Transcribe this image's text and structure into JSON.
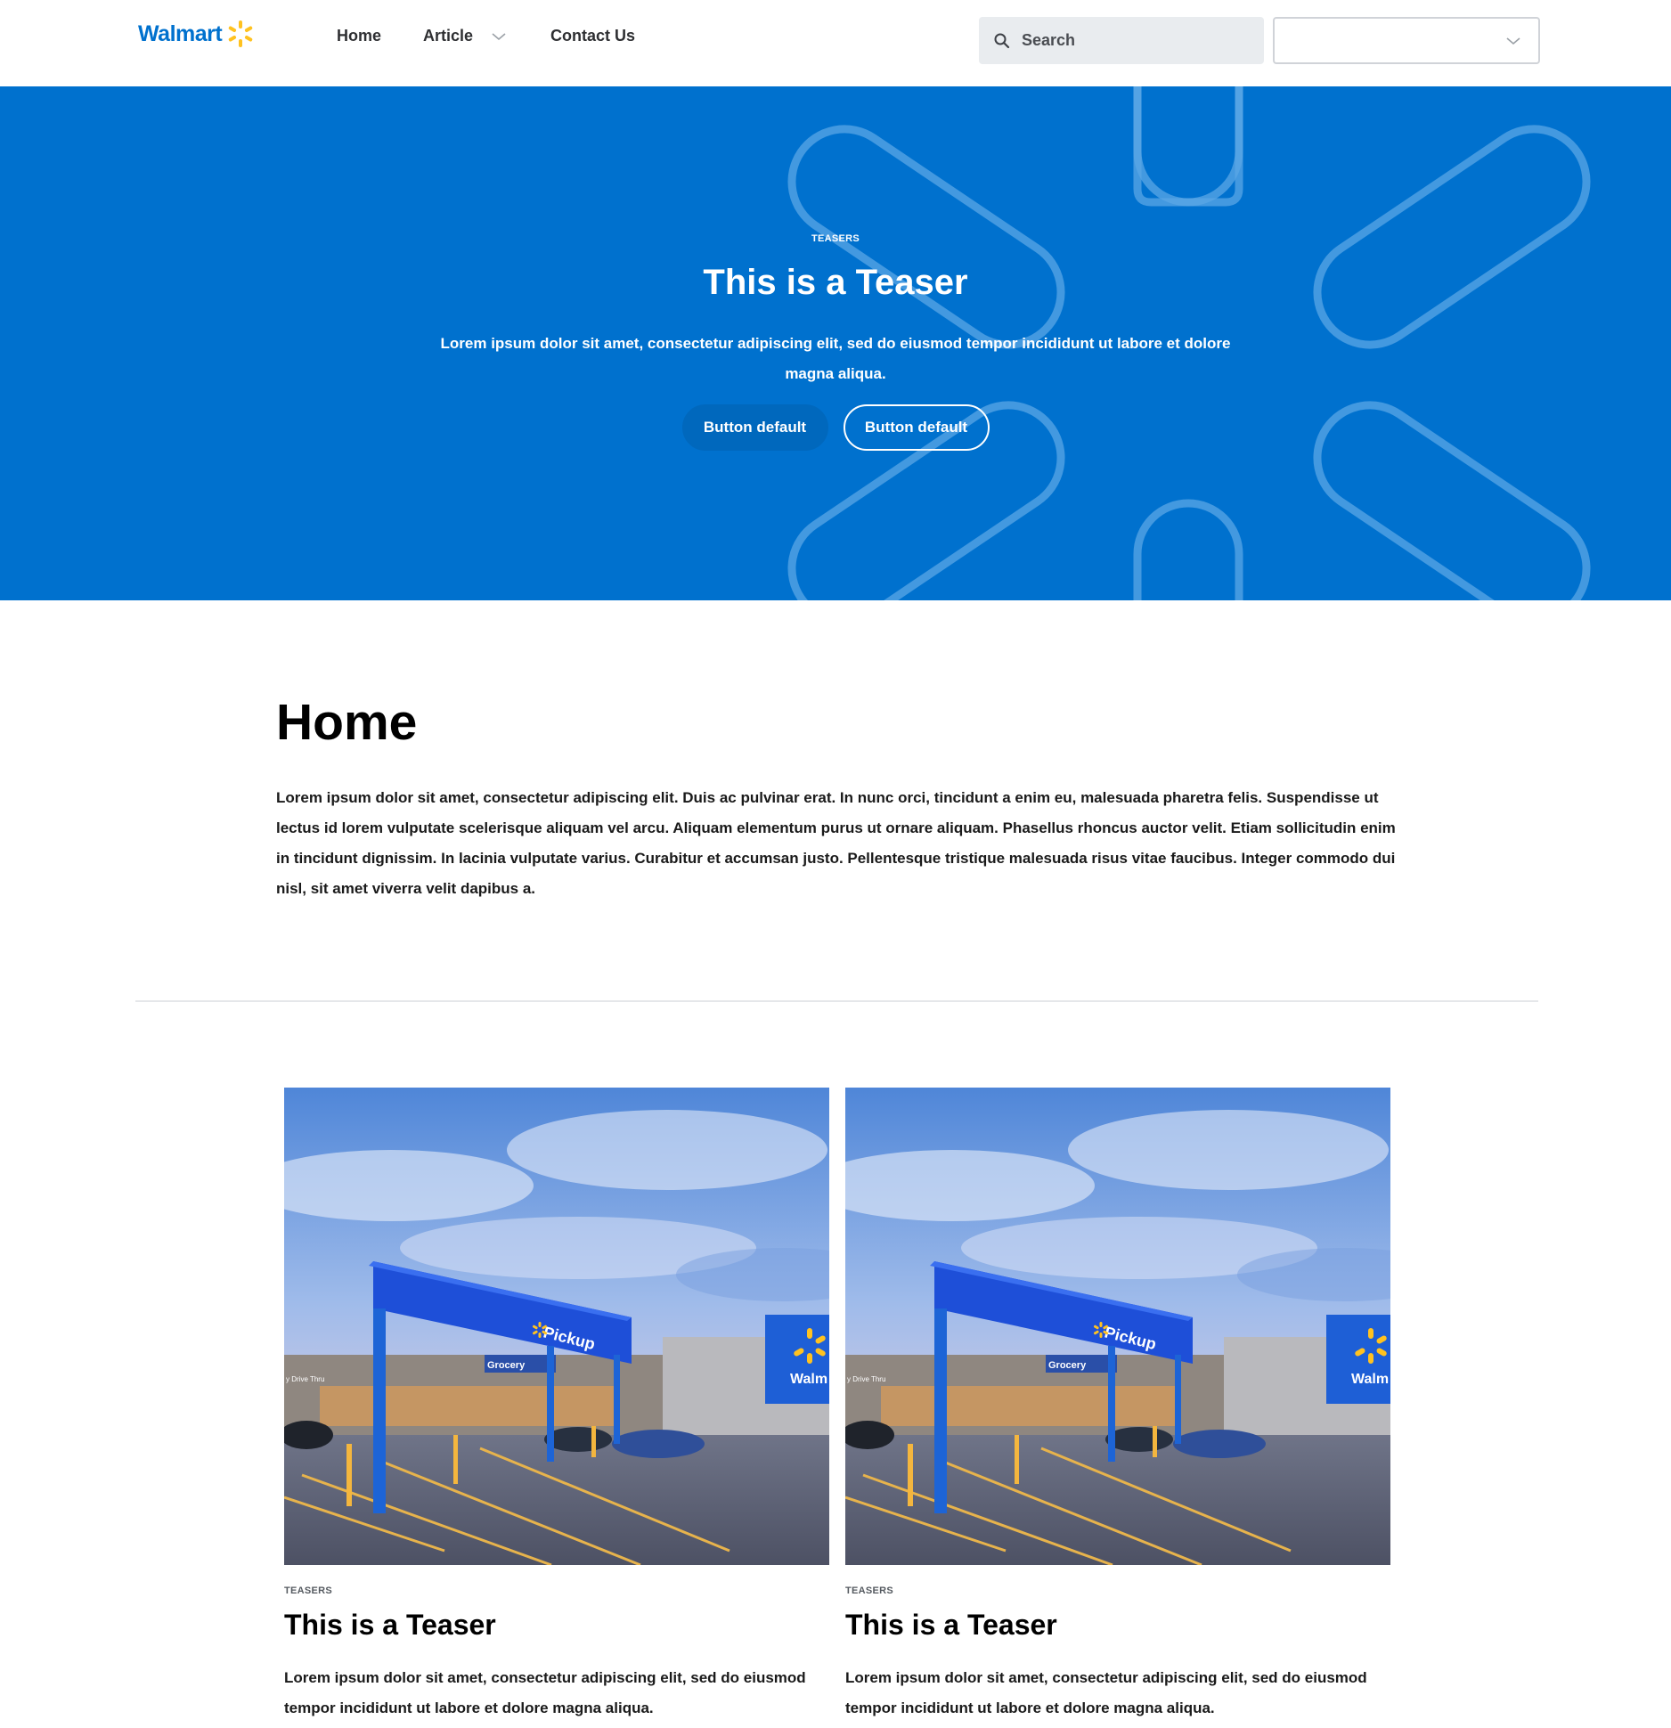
{
  "header": {
    "logo_text": "Walmart",
    "nav": [
      {
        "label": "Home"
      },
      {
        "label": "Article"
      },
      {
        "label": "Contact Us"
      }
    ],
    "search": {
      "placeholder": "Search",
      "value": ""
    },
    "select": {
      "value": ""
    }
  },
  "hero": {
    "eyebrow": "TEASERS",
    "title": "This is a Teaser",
    "description": "Lorem ipsum dolor sit amet, consectetur adipiscing elit, sed do eiusmod tempor incididunt ut labore et dolore magna aliqua.",
    "buttons": [
      {
        "label": "Button default"
      },
      {
        "label": "Button default"
      }
    ]
  },
  "main": {
    "title": "Home",
    "intro": "Lorem ipsum dolor sit amet, consectetur adipiscing elit. Duis ac pulvinar erat. In nunc orci, tincidunt a enim eu, malesuada pharetra felis. Suspendisse ut lectus id lorem vulputate scelerisque aliquam vel arcu. Aliquam elementum purus ut ornare aliquam. Phasellus rhoncus auctor velit. Etiam sollicitudin enim in tincidunt dignissim. In lacinia vulputate varius. Curabitur et accumsan justo. Pellentesque tristique malesuada risus vitae faucibus. Integer commodo dui nisl, sit amet viverra velit dapibus a."
  },
  "cards": [
    {
      "eyebrow": "TEASERS",
      "title": "This is a Teaser",
      "description": "Lorem ipsum dolor sit amet, consectetur adipiscing elit, sed do eiusmod tempor incididunt ut labore et dolore magna aliqua.",
      "image_text": {
        "pickup": "Pickup",
        "grocery": "Grocery",
        "store": "Walm",
        "drive": "y Drive Thru"
      }
    },
    {
      "eyebrow": "TEASERS",
      "title": "This is a Teaser",
      "description": "Lorem ipsum dolor sit amet, consectetur adipiscing elit, sed do eiusmod tempor incididunt ut labore et dolore magna aliqua.",
      "image_text": {
        "pickup": "Pickup",
        "grocery": "Grocery",
        "store": "Walm",
        "drive": "y Drive Thru"
      }
    }
  ],
  "colors": {
    "brand_blue": "#0071ce",
    "brand_yellow": "#ffc220",
    "text": "#000000",
    "hero_pattern": "#6fb1e6"
  },
  "icons": {
    "logo": "spark-icon",
    "search": "search-icon",
    "nav_dropdown": "chevron-down-icon",
    "select_dropdown": "chevron-down-icon"
  }
}
